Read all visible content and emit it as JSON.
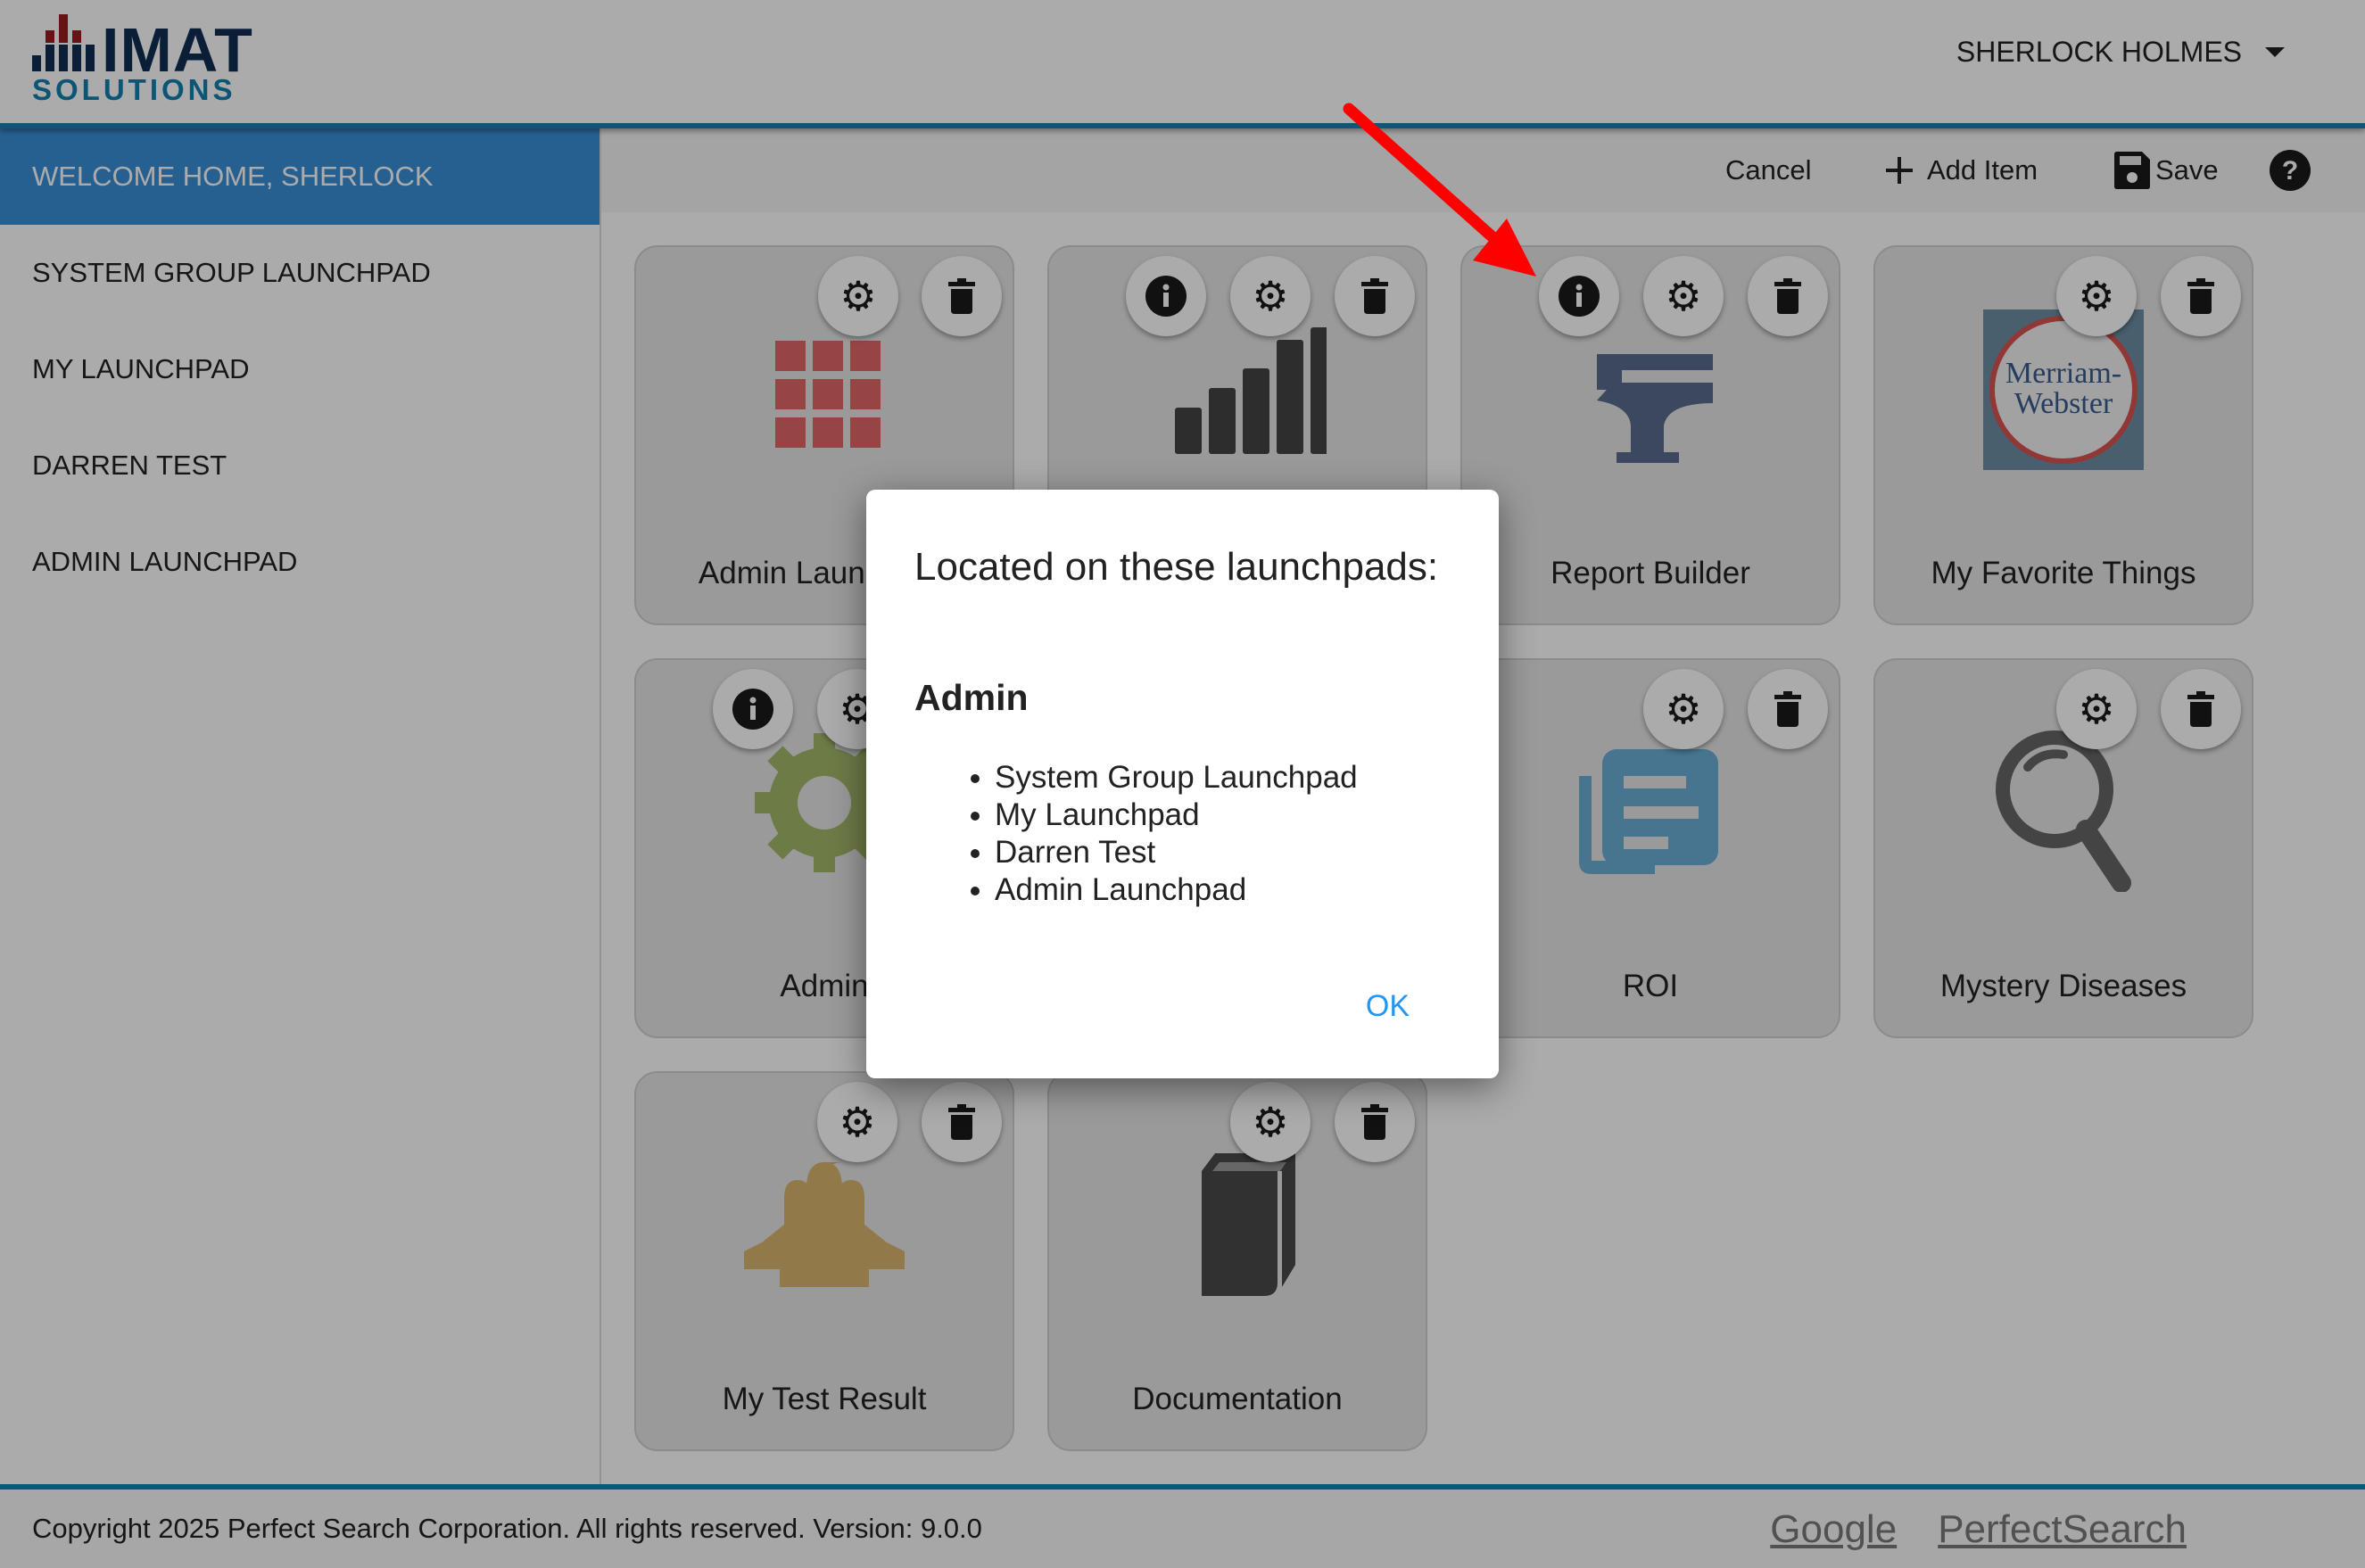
{
  "header": {
    "logo_top": "IMAT",
    "logo_bottom": "SOLUTIONS",
    "user_name": "SHERLOCK HOLMES"
  },
  "sidebar": {
    "items": [
      {
        "label": "WELCOME HOME, SHERLOCK",
        "active": true
      },
      {
        "label": "SYSTEM GROUP LAUNCHPAD",
        "active": false
      },
      {
        "label": "MY LAUNCHPAD",
        "active": false
      },
      {
        "label": "DARREN TEST",
        "active": false
      },
      {
        "label": "ADMIN LAUNCHPAD",
        "active": false
      }
    ]
  },
  "toolbar": {
    "cancel_label": "Cancel",
    "add_item_label": "Add Item",
    "save_label": "Save",
    "help_icon": "question-circle-icon"
  },
  "tiles": [
    {
      "title": "Admin Launchpad",
      "icon": "grid-icon",
      "icon_color": "#e06666",
      "has_info": false
    },
    {
      "title": "",
      "icon": "bar-chart-icon",
      "icon_color": "#444444",
      "has_info": true
    },
    {
      "title": "Report Builder",
      "icon": "anvil-icon",
      "icon_color": "#5a6b8f",
      "has_info": true
    },
    {
      "title": "My Favorite Things",
      "icon": "merriam-webster-logo",
      "icon_color": "#6e8ea3",
      "has_info": false,
      "logo_text": [
        "Merriam-",
        "Webster"
      ]
    },
    {
      "title": "Admin",
      "icon": "gear-large-icon",
      "icon_color": "#a3b86b",
      "has_info": true
    },
    {
      "title": "",
      "icon": "",
      "icon_color": "",
      "has_info": false
    },
    {
      "title": "ROI",
      "icon": "documents-icon",
      "icon_color": "#6aaed6",
      "has_info": false
    },
    {
      "title": "Mystery Diseases",
      "icon": "magnifier-icon",
      "icon_color": "#666666",
      "has_info": false
    },
    {
      "title": "My Test Result",
      "icon": "users-icon",
      "icon_color": "#d8b56d",
      "has_info": false
    },
    {
      "title": "Documentation",
      "icon": "book-icon",
      "icon_color": "#4a4a4a",
      "has_info": false
    }
  ],
  "modal": {
    "title": "Located on these launchpads:",
    "group": "Admin",
    "launchpads": [
      "System Group Launchpad",
      "My Launchpad",
      "Darren Test",
      "Admin Launchpad"
    ],
    "ok_label": "OK"
  },
  "footer": {
    "copyright": "Copyright 2025 Perfect Search Corporation. All rights reserved. Version: 9.0.0",
    "links": [
      "Google",
      "PerfectSearch"
    ]
  },
  "colors": {
    "brand_blue": "#1283b5",
    "active_nav": "#3a8fd9",
    "ok_blue": "#2196f3",
    "annotation_arrow": "#ff0000"
  }
}
